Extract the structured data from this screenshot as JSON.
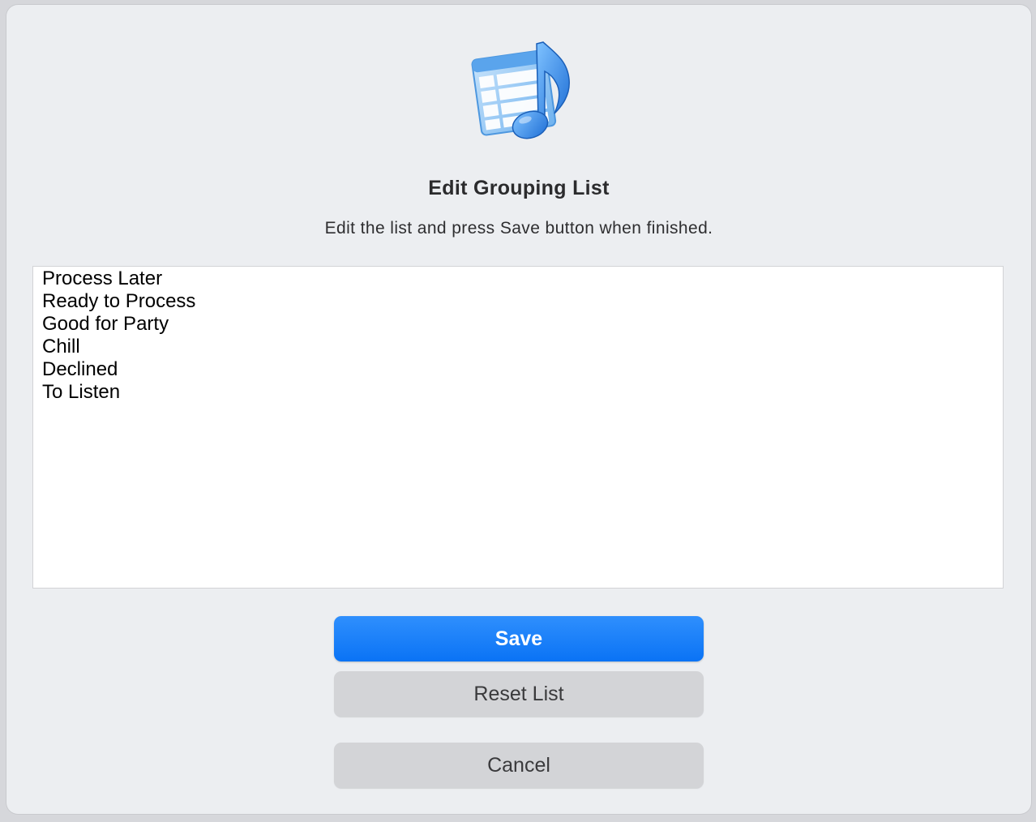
{
  "dialog": {
    "icon": "music-table-app-icon",
    "title": "Edit Grouping List",
    "subtitle": "Edit the list and press Save button when finished.",
    "list_items": [
      "Process Later",
      "Ready to Process",
      "Good for Party",
      "Chill",
      "Declined",
      "To Listen"
    ],
    "buttons": {
      "save_label": "Save",
      "reset_label": "Reset List",
      "cancel_label": "Cancel"
    }
  },
  "colors": {
    "accent": "#0a73f5",
    "background": "#eceef1",
    "secondary_button": "#d3d4d7"
  }
}
